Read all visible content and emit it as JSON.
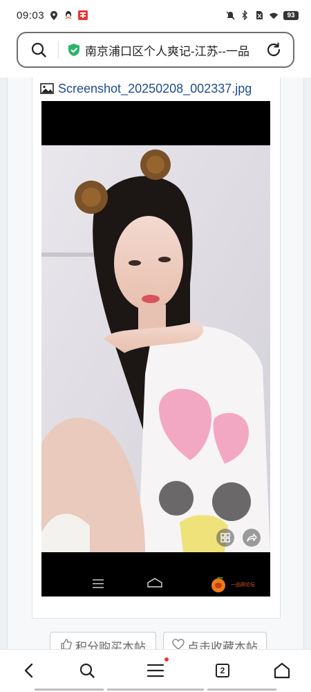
{
  "status_bar": {
    "time": "09:03",
    "battery": "93",
    "left_icons": [
      "location-pin-icon",
      "qq-penguin-icon",
      "red-app-icon"
    ],
    "right_icons": [
      "mute-bell-icon",
      "bluetooth-icon",
      "no-sim-icon",
      "wifi-icon"
    ]
  },
  "address_bar": {
    "title": "南京浦口区个人爽记-江苏--一品",
    "secure_color": "#2bb36a"
  },
  "attachment": {
    "filename": "Screenshot_20250208_002337.jpg"
  },
  "overlay": {
    "logo_text": "一品网论坛"
  },
  "actions": {
    "buy_label": "积分购买本帖",
    "favorite_label": "点击收藏本帖"
  },
  "bottom_bar": {
    "tab_count": "2",
    "items": [
      "back-icon",
      "search-icon",
      "menu-icon",
      "tabs-icon",
      "home-icon"
    ]
  }
}
